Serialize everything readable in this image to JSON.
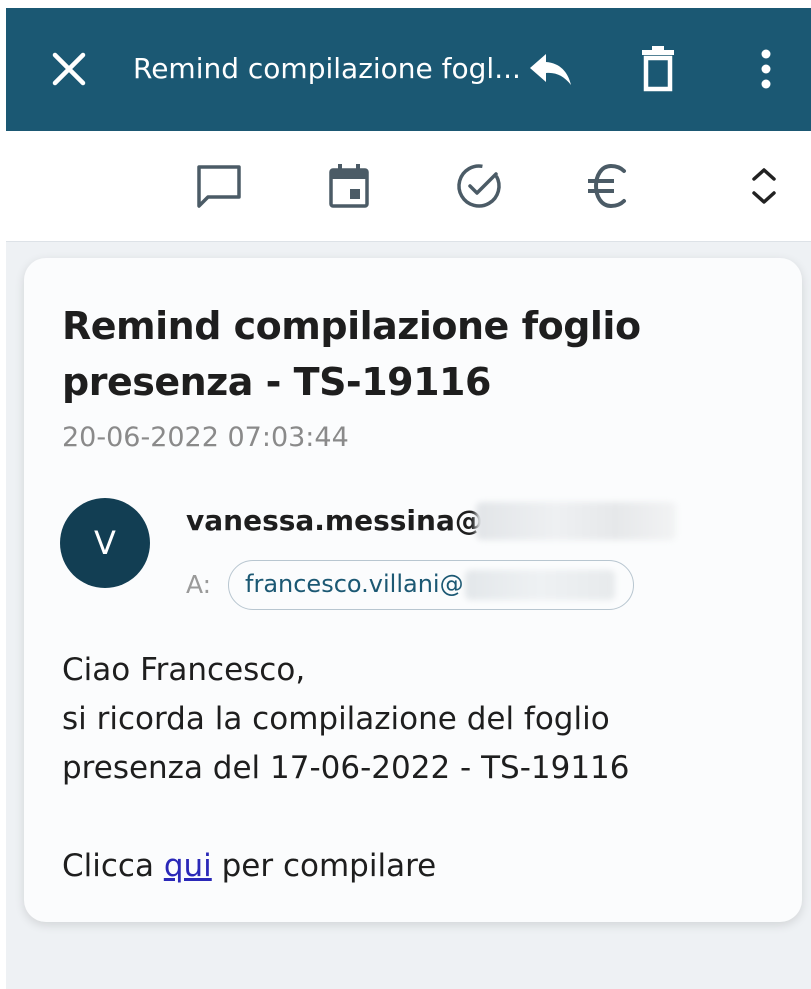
{
  "appbar": {
    "title": "Remind compilazione fogl...",
    "icons": [
      "close-icon",
      "reply-icon",
      "trash-icon",
      "more-vert-icon"
    ],
    "background": "#1b5873"
  },
  "toolbar": {
    "icons": [
      "comment-icon",
      "calendar-icon",
      "check-circle-icon",
      "euro-icon",
      "expand-icon"
    ]
  },
  "email": {
    "subject": "Remind compilazione foglio presenza - TS-19116",
    "date": "20-06-2022 07:03:44",
    "avatar_initial": "V",
    "sender": "vanessa.messina@",
    "to_label": "A:",
    "recipient": "francesco.villani@",
    "body": {
      "greeting": "Ciao Francesco,",
      "line1": "si ricorda la compilazione del foglio",
      "line2": "presenza del 17-06-2022 - TS-19116",
      "cta_prefix": "Clicca ",
      "cta_link": "qui",
      "cta_suffix": " per compilare"
    }
  },
  "colors": {
    "accent": "#1b5873",
    "avatar": "#123e53",
    "link": "#2a28b8"
  }
}
